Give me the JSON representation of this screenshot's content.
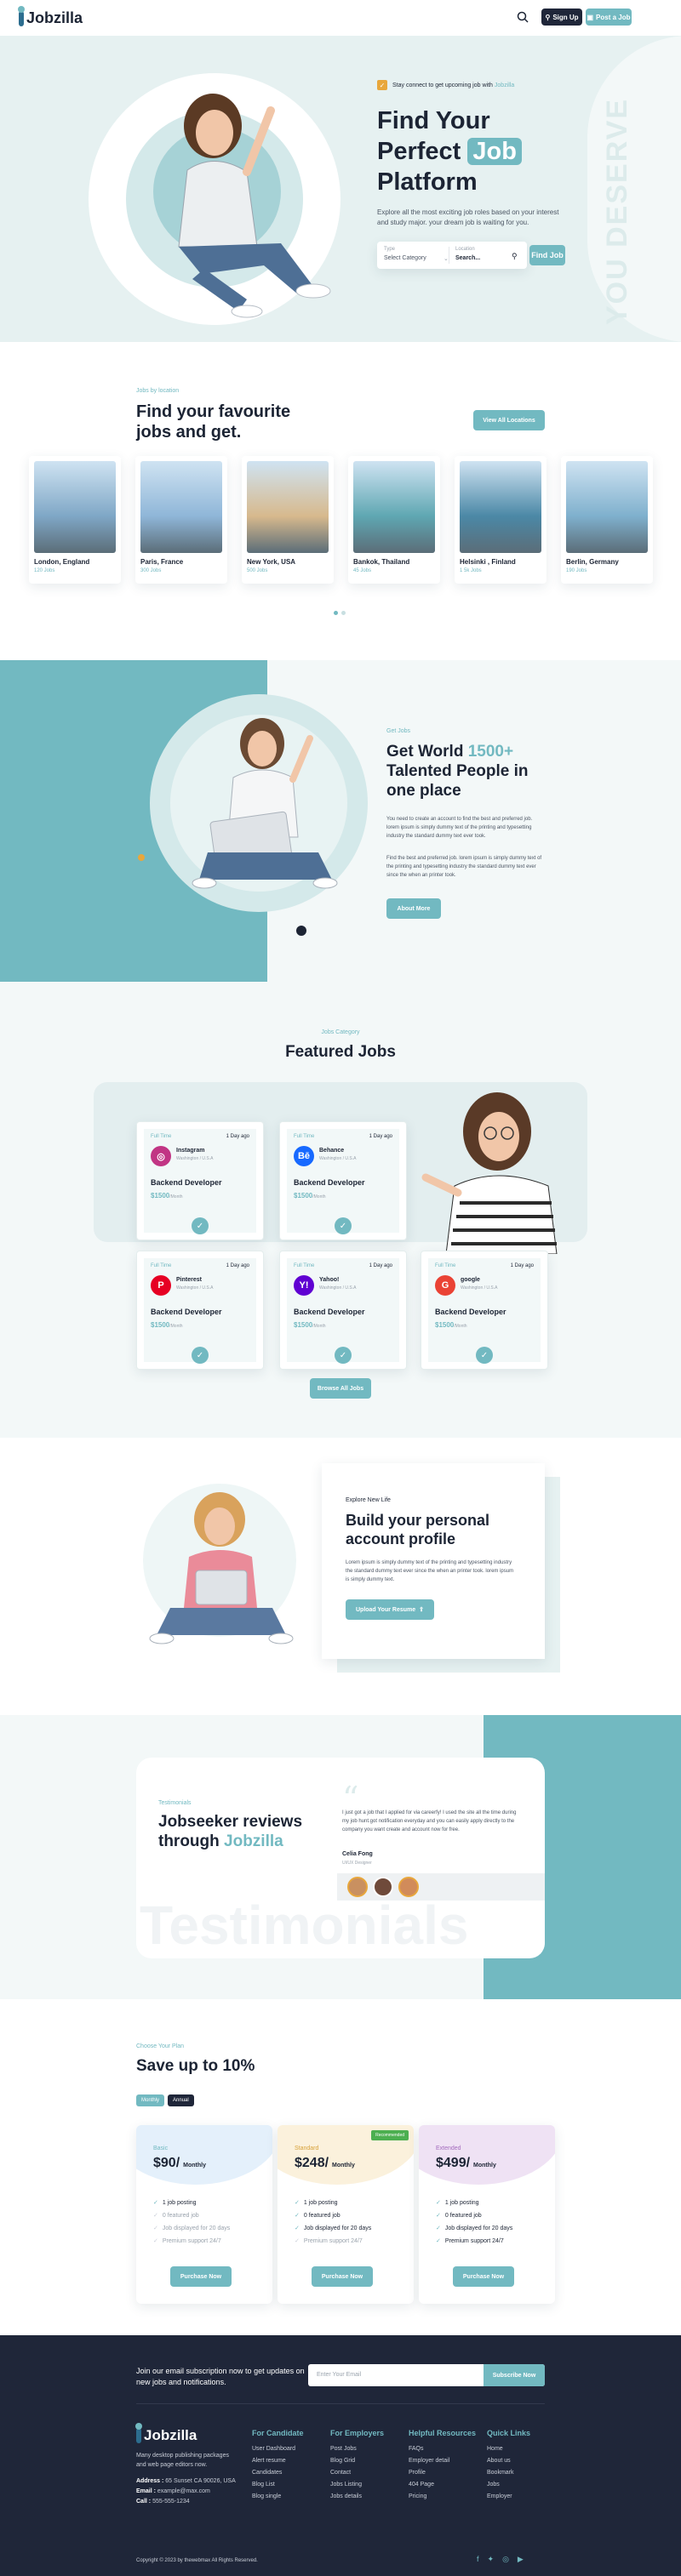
{
  "header": {
    "logo": "Jobzilla",
    "signup_label": "Sign Up",
    "postjob_label": "Post a Job"
  },
  "hero": {
    "notice": "Stay connect to get upcoming job with ",
    "notice_brand": "Jobzilla",
    "title_line1": "Find Your",
    "title_line2a": "Perfect ",
    "title_highlight": "Job",
    "title_line3": "Platform",
    "desc": "Explore all the most exciting job roles based on your interest and study major. your dream job is waiting for you.",
    "type_label": "Type",
    "type_value": "Select Category",
    "location_label": "Location",
    "location_placeholder": "Search...",
    "find_button": "Find Job",
    "vertical_text": "YOU DESERVE"
  },
  "locations": {
    "eyebrow": "Jobs by location",
    "title_line1": "Find your favourite",
    "title_line2": "jobs and get.",
    "view_all": "View All Locations",
    "items": [
      {
        "name": "London, England",
        "jobs": "120 Jobs",
        "color": "#7fa7c6"
      },
      {
        "name": "Paris, France",
        "jobs": "300 Jobs",
        "color": "#8fb6d8"
      },
      {
        "name": "New York, USA",
        "jobs": "500 Jobs",
        "color": "#d7b98d"
      },
      {
        "name": "Bankok, Thailand",
        "jobs": "45 Jobs",
        "color": "#5fa7b2"
      },
      {
        "name": "Helsinki , Finland",
        "jobs": "1 5k Jobs",
        "color": "#4b88a6"
      },
      {
        "name": "Berlin, Germany",
        "jobs": "190 Jobs",
        "color": "#7fb0cd"
      }
    ]
  },
  "talent": {
    "eyebrow": "Get Jobs",
    "title_a": "Get World ",
    "title_hl": "1500+",
    "title_b": "Talented People in",
    "title_c": "one place",
    "para1": "You need to create an account to find the best and preferred job. lorem ipsum is simply dummy text of the printing and typesetting industry the standard dummy text ever took.",
    "para2": "Find the best and preferred job. lorem ipsum is simply dummy text of the printing and typesetting industry the standard dummy text ever since the when an printer took.",
    "button": "About More"
  },
  "featured": {
    "eyebrow": "Jobs Category",
    "title": "Featured Jobs",
    "view_all": "Browse All Jobs",
    "jobs": [
      {
        "type": "Full Time",
        "date": "1 Day ago",
        "company": "Instagram",
        "location": "Washington / U.S.A",
        "role": "Backend Developer",
        "salary": "$1500",
        "period": "/Month",
        "logo_color": "#c13584",
        "logo_char": "◎",
        "type_color": "#72b9c1"
      },
      {
        "type": "Full Time",
        "date": "1 Day ago",
        "company": "Behance",
        "location": "Washington / U.S.A",
        "role": "Backend Developer",
        "salary": "$1500",
        "period": "/Month",
        "logo_color": "#1769ff",
        "logo_char": "Bē",
        "type_color": "#72b9c1"
      },
      {
        "type": "Full Time",
        "date": "1 Day ago",
        "company": "Pinterest",
        "location": "Washington / U.S.A",
        "role": "Backend Developer",
        "salary": "$1500",
        "period": "/Month",
        "logo_color": "#e60023",
        "logo_char": "P",
        "type_color": "#72b9c1"
      },
      {
        "type": "Full Time",
        "date": "1 Day ago",
        "company": "Yahoo!",
        "location": "Washington / U.S.A",
        "role": "Backend Developer",
        "salary": "$1500",
        "period": "/Month",
        "logo_color": "#6001d2",
        "logo_char": "Y!",
        "type_color": "#72b9c1"
      },
      {
        "type": "Full Time",
        "date": "1 Day ago",
        "company": "google",
        "location": "Washington / U.S.A",
        "role": "Backend Developer",
        "salary": "$1500",
        "period": "/Month",
        "logo_color": "#ea4335",
        "logo_char": "G",
        "type_color": "#72b9c1"
      }
    ]
  },
  "profile": {
    "eyebrow": "Explore New Life",
    "title_line1": "Build your personal",
    "title_line2": "account profile",
    "desc": "Lorem ipsum is simply dummy text of the printing and typesetting industry the standard dummy text ever since the when an printer took. lorem ipsum is simply dummy text.",
    "button": "Upload Your Resume"
  },
  "testimonials": {
    "eyebrow": "Testimonials",
    "title_line1": "Jobseeker reviews",
    "title_line2a": "through ",
    "title_brand": "Jobzilla",
    "quote": "I just got a job that I applied for via careerfy! I used the site all the time during my job hunt.got notification everyday and you can easily apply directly to the company you want create and account now for free.",
    "author": "Celia Fong",
    "author_role": "UI/UX Designer",
    "watermark": "Testimonials"
  },
  "pricing": {
    "eyebrow": "Choose Your Plan",
    "title": "Save up to 10%",
    "toggle_monthly": "Monthly",
    "toggle_annual": "Annual",
    "plans": [
      {
        "name": "Basic",
        "price": "$90/",
        "period": "Monthly",
        "button": "Purchase Now",
        "tint": "#e4f0fb",
        "name_color": "#72b9c1",
        "features": [
          {
            "text": "1 job posting",
            "on": true
          },
          {
            "text": "0 featured job",
            "on": false
          },
          {
            "text": "Job displayed for 20 days",
            "on": false
          },
          {
            "text": "Premium support 24/7",
            "on": false
          }
        ]
      },
      {
        "name": "Standard",
        "price": "$248/",
        "period": "Monthly",
        "button": "Purchase Now",
        "tint": "#fbf1dc",
        "name_color": "#d8a23a",
        "badge": "Recommended",
        "features": [
          {
            "text": "1 job posting",
            "on": true
          },
          {
            "text": "0 featured job",
            "on": true
          },
          {
            "text": "Job displayed for 20 days",
            "on": true
          },
          {
            "text": "Premium support 24/7",
            "on": false
          }
        ]
      },
      {
        "name": "Extended",
        "price": "$499/",
        "period": "Monthly",
        "button": "Purchase Now",
        "tint": "#efe2f4",
        "name_color": "#a36bbd",
        "features": [
          {
            "text": "1 job posting",
            "on": true
          },
          {
            "text": "0 featured job",
            "on": true
          },
          {
            "text": "Job displayed for 20 days",
            "on": true
          },
          {
            "text": "Premium support 24/7",
            "on": true
          }
        ]
      }
    ]
  },
  "footer": {
    "subscribe_text": "Join our email subscription now to get updates on new jobs and notifications.",
    "email_placeholder": "Enter Your Email",
    "subscribe_button": "Subscribe Now",
    "logo": "Jobzilla",
    "about": "Many desktop publishing packages and web page editors now.",
    "address_label": "Address :",
    "address": " 65 Sunset CA 90026, USA",
    "email_label": "Email :",
    "email": " example@max.com",
    "call_label": "Call :",
    "call": " 555-555-1234",
    "columns": [
      {
        "title": "For Candidate",
        "links": [
          "User Dashboard",
          "Alert resume",
          "Candidates",
          "Blog List",
          "Blog single"
        ]
      },
      {
        "title": "For Employers",
        "links": [
          "Post Jobs",
          "Blog Grid",
          "Contact",
          "Jobs Listing",
          "Jobs details"
        ]
      },
      {
        "title": "Helpful Resources",
        "links": [
          "FAQs",
          "Employer detail",
          "Profile",
          "404 Page",
          "Pricing"
        ]
      },
      {
        "title": "Quick Links",
        "links": [
          "Home",
          "About us",
          "Bookmark",
          "Jobs",
          "Employer"
        ]
      }
    ],
    "copyright": "Copyright © 2023 by thewebmax All Rights Reserved."
  },
  "colors": {
    "accent": "#72b9c1",
    "dark": "#1c2434",
    "footer": "#1f2639"
  }
}
